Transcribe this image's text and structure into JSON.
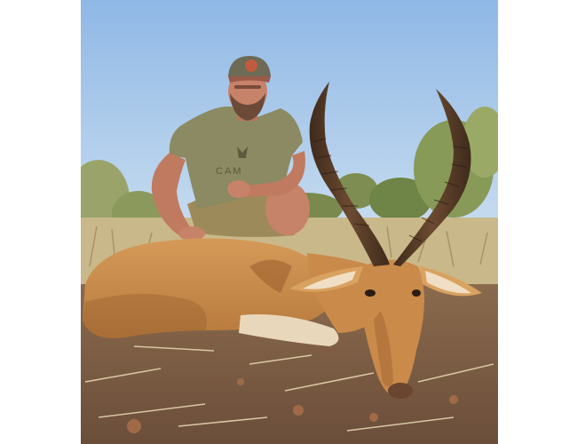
{
  "image": {
    "subject": "hunter-with-impala-trophy",
    "cap_logo": "cap-logo",
    "shirt_print": "CAM",
    "colors": {
      "sky_top": "#8fb8e6",
      "sky_bottom": "#c7dcef",
      "shirt": "#8b8a62",
      "shorts": "#9d8a5a",
      "cap": "#6d6a55",
      "cap_bill": "#9a5a48",
      "skin": "#c7826a",
      "beard": "#6b4a38",
      "impala_body": "#c98a4a",
      "impala_shadow": "#8e5a2b",
      "horn": "#5a3b26",
      "grass": "#c9b889",
      "ground": "#7b5a43",
      "bush": "#8b9a5c"
    }
  }
}
